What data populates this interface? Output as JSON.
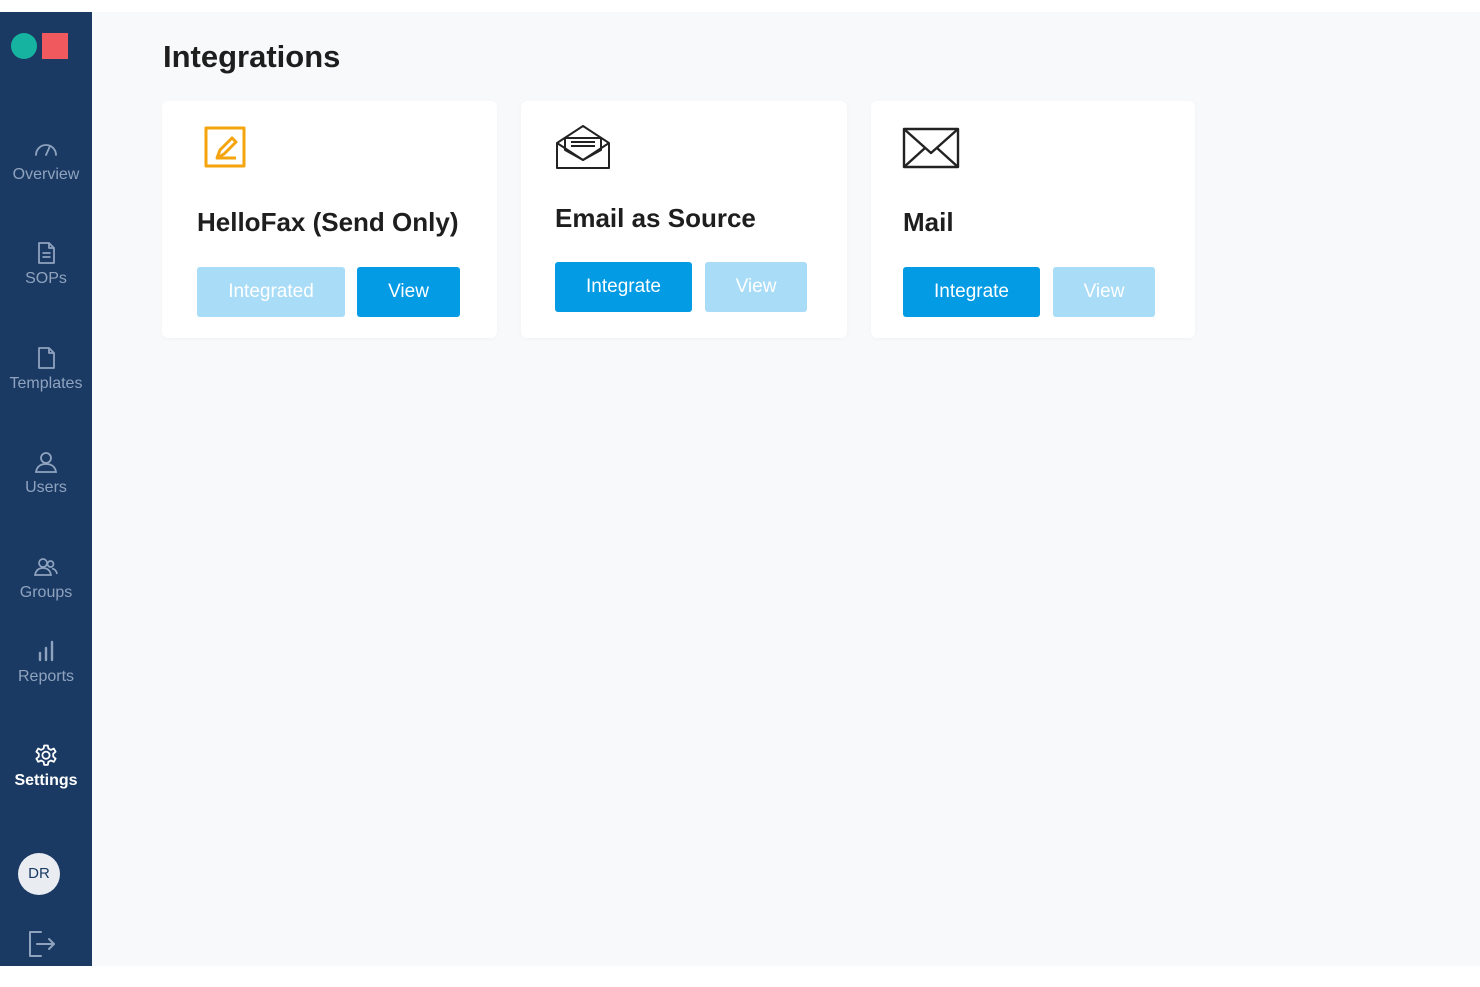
{
  "sidebar": {
    "items": [
      {
        "label": "Overview",
        "icon": "gauge-icon"
      },
      {
        "label": "SOPs",
        "icon": "document-icon"
      },
      {
        "label": "Templates",
        "icon": "file-icon"
      },
      {
        "label": "Users",
        "icon": "user-icon"
      },
      {
        "label": "Groups",
        "icon": "group-icon"
      },
      {
        "label": "Reports",
        "icon": "bar-chart-icon"
      },
      {
        "label": "Settings",
        "icon": "gear-icon",
        "active": true
      }
    ],
    "avatar_initials": "DR",
    "logout_icon": "logout-icon"
  },
  "main": {
    "title": "Integrations",
    "cards": [
      {
        "title": "HelloFax (Send Only)",
        "icon": "edit-square-icon",
        "primary_label": "Integrated",
        "secondary_label": "View"
      },
      {
        "title": "Email as Source",
        "icon": "open-envelope-icon",
        "primary_label": "Integrate",
        "secondary_label": "View"
      },
      {
        "title": "Mail",
        "icon": "envelope-icon",
        "primary_label": "Integrate",
        "secondary_label": "View"
      }
    ]
  },
  "colors": {
    "sidebar_bg": "#1a3a63",
    "accent_blue": "#049be5",
    "disabled_blue": "#a9dcf7",
    "logo_teal": "#16b3a0",
    "logo_red": "#f05a5f",
    "hellofax_icon": "#f5a40e"
  }
}
